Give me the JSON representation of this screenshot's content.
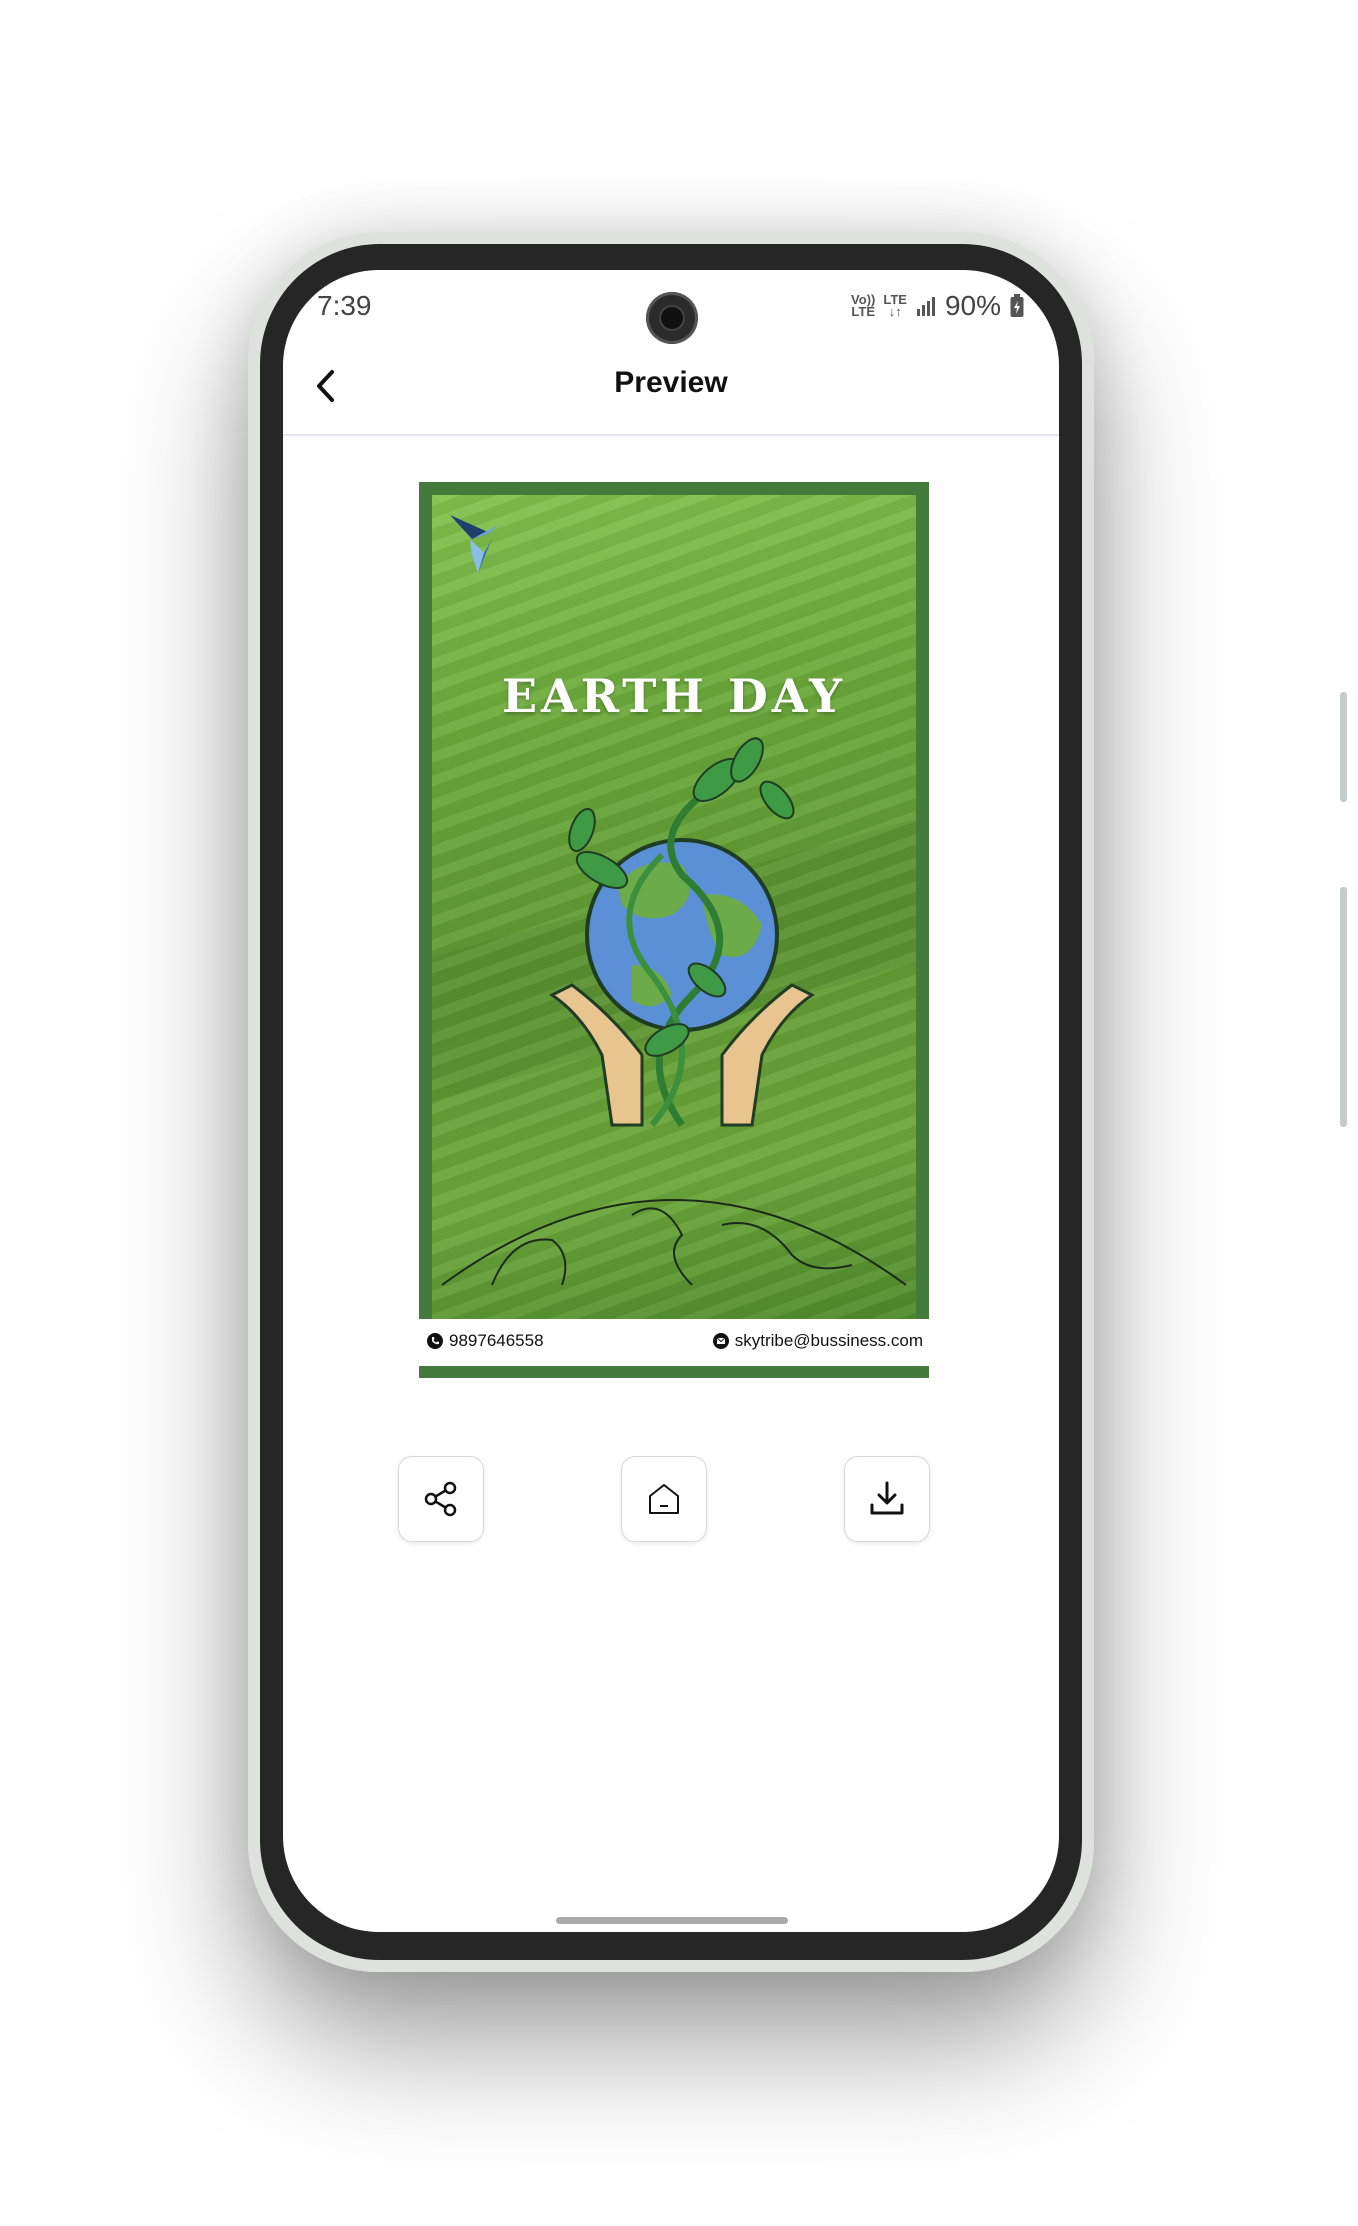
{
  "status_bar": {
    "time": "7:39",
    "net1_top": "Vo))",
    "net1_bottom": "LTE",
    "net2_top": "LTE",
    "net2_bottom": "↓↑",
    "battery": "90%"
  },
  "app_bar": {
    "title": "Preview",
    "back_icon": "chevron-left-icon"
  },
  "poster": {
    "title": "EARTH DAY",
    "phone": "9897646558",
    "email": "skytribe@bussiness.com",
    "colors": {
      "frame": "#447a3b",
      "grass": "#6aa83a",
      "earth": "#5b8fd6"
    }
  },
  "actions": [
    {
      "icon": "share-icon"
    },
    {
      "icon": "home-icon"
    },
    {
      "icon": "download-icon"
    }
  ]
}
